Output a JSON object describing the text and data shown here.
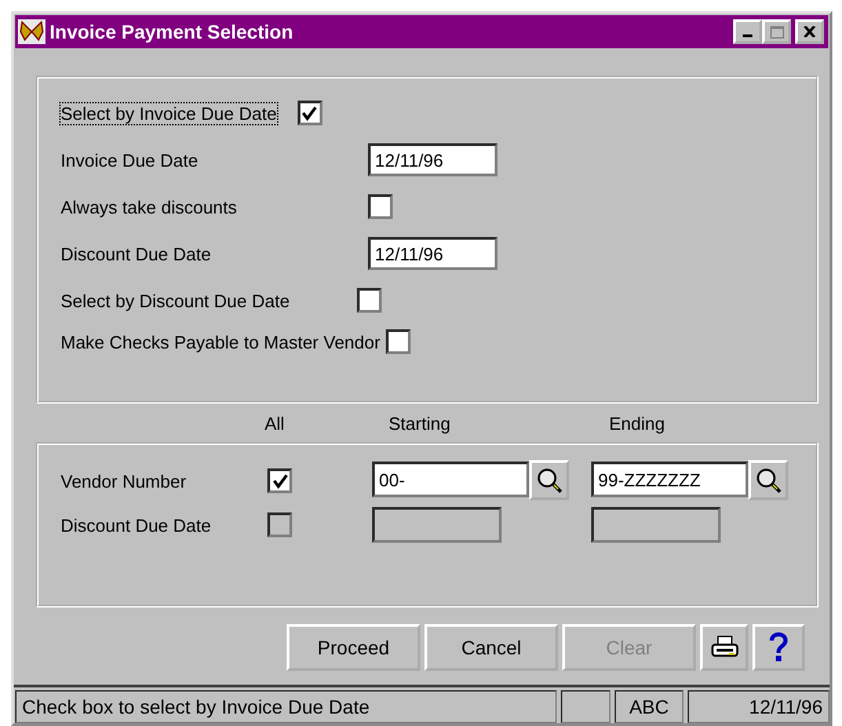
{
  "window": {
    "title": "Invoice Payment Selection"
  },
  "options": [
    {
      "kind": "checkbox",
      "label": "Select by Invoice Due Date",
      "checked": true,
      "focused": true
    },
    {
      "kind": "date",
      "label": "Invoice Due Date",
      "value": "12/11/96",
      "focused": false
    },
    {
      "kind": "checkbox",
      "label": "Always take discounts",
      "checked": false,
      "focused": false
    },
    {
      "kind": "date",
      "label": "Discount Due Date",
      "value": "12/11/96",
      "focused": false
    },
    {
      "kind": "checkbox",
      "label": "Select by Discount Due Date",
      "checked": false,
      "focused": false
    },
    {
      "kind": "checkbox",
      "label": "Make Checks Payable to Master Vendor",
      "checked": false,
      "focused": false
    }
  ],
  "range_headers": {
    "all": "All",
    "starting": "Starting",
    "ending": "Ending"
  },
  "ranges": [
    {
      "label": "Vendor Number",
      "all": true,
      "disabled": false,
      "starting": "00-",
      "ending": "99-ZZZZZZZ"
    },
    {
      "label": "Discount Due Date",
      "all": false,
      "disabled": true
    }
  ],
  "buttons": [
    {
      "label": "Proceed",
      "disabled": false
    },
    {
      "label": "Cancel",
      "disabled": false
    },
    {
      "label": "Clear",
      "disabled": true
    }
  ],
  "status_bar": {
    "message": "Check box to select by Invoice Due Date",
    "indicator": "ABC",
    "date": "12/11/96"
  }
}
